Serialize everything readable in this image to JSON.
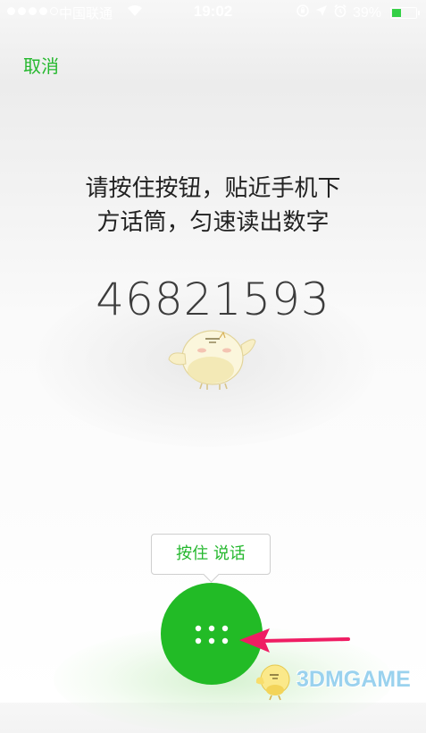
{
  "status_bar": {
    "carrier": "中国联通",
    "time": "19:02",
    "battery_percent": "39%",
    "battery_level": 0.39,
    "signal_bars": 4,
    "icons": [
      "wifi-icon",
      "rotation-lock-icon",
      "location-icon",
      "alarm-icon",
      "battery-icon"
    ]
  },
  "nav": {
    "cancel_label": "取消"
  },
  "instruction": {
    "line1": "请按住按钮，贴近手机下",
    "line2": "方话筒，匀速读出数字"
  },
  "verification": {
    "digits": "46821593"
  },
  "tooltip": {
    "label": "按住 说话"
  },
  "talk_button": {
    "icon": "dots-grid-icon"
  },
  "watermark": {
    "text": "3DMGAME"
  },
  "colors": {
    "accent": "#22bb26",
    "link_green": "#25b82e",
    "annotation_arrow": "#ef1d63",
    "battery_fill": "#35d046"
  }
}
